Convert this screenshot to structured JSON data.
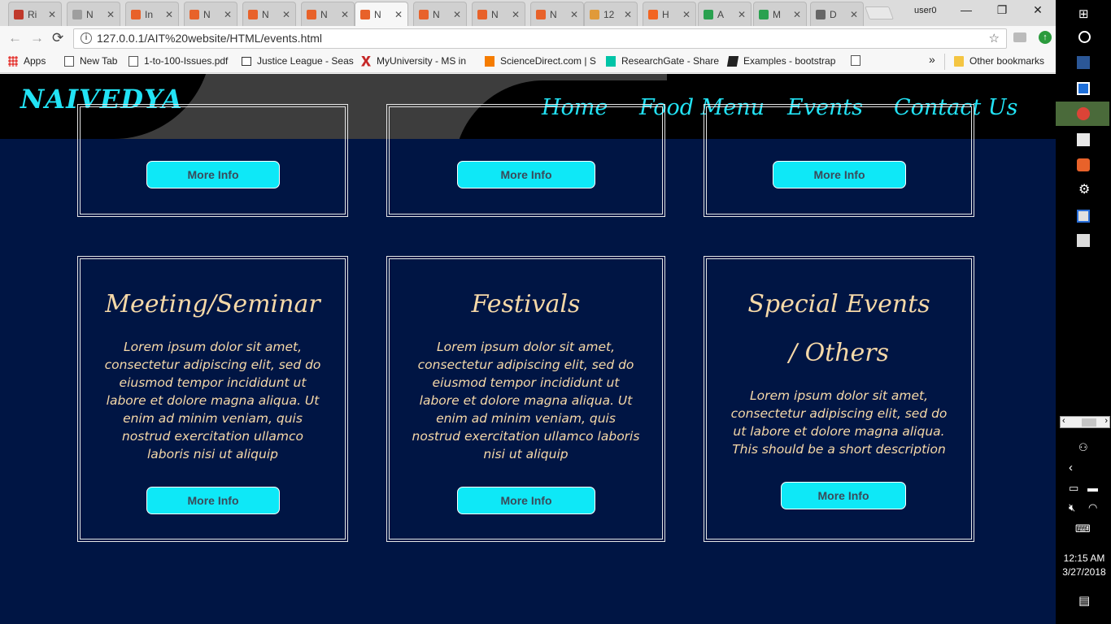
{
  "browser": {
    "tabs": [
      {
        "title": "Ri",
        "color": "#c0392b"
      },
      {
        "title": "N",
        "color": "#9e9e9e"
      },
      {
        "title": "In",
        "color": "#e8622a"
      },
      {
        "title": "N",
        "color": "#e8622a"
      },
      {
        "title": "N",
        "color": "#e8622a"
      },
      {
        "title": "N",
        "color": "#e8622a"
      },
      {
        "title": "N",
        "color": "#e8622a"
      },
      {
        "title": "N",
        "color": "#e8622a"
      },
      {
        "title": "N",
        "color": "#e8622a"
      },
      {
        "title": "N",
        "color": "#e8622a"
      },
      {
        "title": "12",
        "color": "#e09a3a"
      },
      {
        "title": "H",
        "color": "#f26522"
      },
      {
        "title": "A",
        "color": "#2aa14f"
      },
      {
        "title": "M",
        "color": "#2aa14f"
      },
      {
        "title": "D",
        "color": "#666666"
      }
    ],
    "active_tab_index": 6,
    "close_glyph": "✕",
    "username": "user0",
    "window_controls": [
      "—",
      "❐",
      "✕"
    ],
    "url": "127.0.0.1/AIT%20website/HTML/events.html",
    "bookmarks": [
      {
        "label": "Apps",
        "icon": "apps-grid-icon"
      },
      {
        "label": "New Tab",
        "icon": "page-icon"
      },
      {
        "label": "1-to-100-Issues.pdf",
        "icon": "page-icon"
      },
      {
        "label": "Justice League - Seas",
        "icon": "screen-icon"
      },
      {
        "label": "MyUniversity - MS in",
        "icon": "x-logo-icon"
      },
      {
        "label": "ScienceDirect.com | S",
        "icon": "e-logo-icon"
      },
      {
        "label": "ResearchGate - Share",
        "icon": "rg-logo-icon"
      },
      {
        "label": "Examples - bootstrap",
        "icon": "book-icon"
      },
      {
        "label": "",
        "icon": "page-icon"
      }
    ],
    "overflow_glyph": "»",
    "other_bookmarks": "Other bookmarks"
  },
  "site": {
    "brand": "NAIVEDYA",
    "nav": [
      "Home",
      "Food Menu",
      "Events",
      "Contact Us"
    ],
    "more_info": "More Info",
    "cards": [
      {
        "title": "Meeting/Seminar",
        "desc": "Lorem ipsum dolor sit amet, consectetur adipiscing elit, sed do eiusmod tempor incididunt ut labore et dolore magna aliqua. Ut enim ad minim veniam, quis nostrud exercitation ullamco laboris nisi ut aliquip"
      },
      {
        "title": "Festivals",
        "desc": "Lorem ipsum dolor sit amet, consectetur adipiscing elit, sed do eiusmod tempor incididunt ut labore et dolore magna aliqua. Ut enim ad minim veniam, quis nostrud exercitation ullamco laboris nisi ut aliquip"
      },
      {
        "title": "Special Events / Others",
        "desc": "Lorem ipsum dolor sit amet, consectetur adipiscing elit, sed do ut labore et dolore magna aliqua. This should be a short description"
      }
    ]
  },
  "taskbar": {
    "time": "12:15 AM",
    "date": "3/27/2018"
  },
  "colors": {
    "page_bg": "#001544",
    "accent_cyan": "#0ee8f7",
    "card_text": "#f6d9a8"
  }
}
